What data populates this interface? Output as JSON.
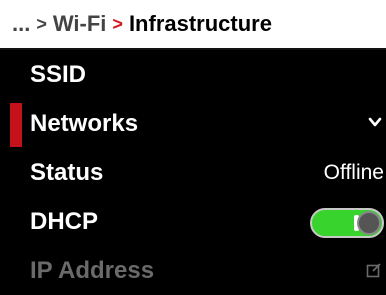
{
  "header": {
    "ellipsis": "...",
    "parent": "Wi-Fi",
    "current": "Infrastructure",
    "separator_gray": ">",
    "separator_red": ">"
  },
  "rows": {
    "ssid": {
      "label": "SSID"
    },
    "networks": {
      "label": "Networks",
      "icon": "chevron-down-icon"
    },
    "status": {
      "label": "Status",
      "value": "Offline"
    },
    "dhcp": {
      "label": "DHCP",
      "toggle_state": "on"
    },
    "ip_address": {
      "label": "IP Address",
      "icon": "edit-icon"
    }
  },
  "colors": {
    "accent_red": "#c4111a",
    "toggle_green": "#38d32d",
    "header_bg": "#ffffff",
    "list_bg": "#000000"
  }
}
